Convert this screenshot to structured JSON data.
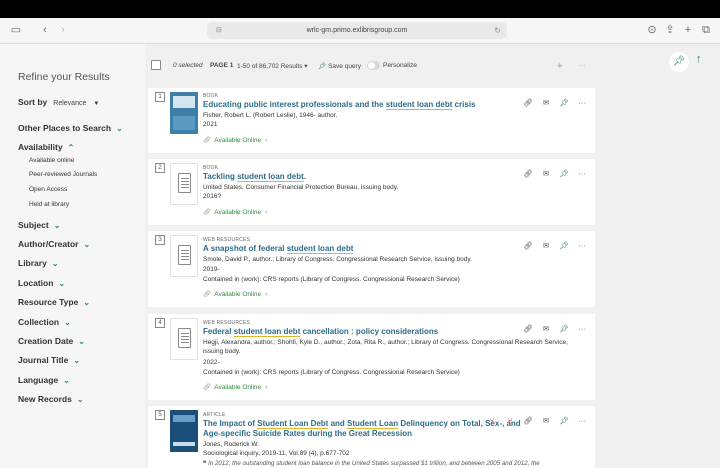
{
  "browser": {
    "url": "wrlc-gm.primo.exlibrisgroup.com"
  },
  "sidebar": {
    "title": "Refine your Results",
    "sort_by": {
      "label": "Sort by",
      "value": "Relevance"
    },
    "facets": [
      {
        "label": "Other Places to Search"
      },
      {
        "label": "Availability"
      },
      {
        "label": "Subject"
      },
      {
        "label": "Author/Creator"
      },
      {
        "label": "Library"
      },
      {
        "label": "Location"
      },
      {
        "label": "Resource Type"
      },
      {
        "label": "Collection"
      },
      {
        "label": "Creation Date"
      },
      {
        "label": "Journal Title"
      },
      {
        "label": "Language"
      },
      {
        "label": "New Records"
      }
    ],
    "availability_options": [
      "Available online",
      "Peer-reviewed Journals",
      "Open Access",
      "Held at library"
    ]
  },
  "toolbar": {
    "selected": "0 selected",
    "page": "PAGE 1",
    "results": "1-50 of 86,702 Results",
    "save_query": "Save query",
    "personalize": "Personalize"
  },
  "results": [
    {
      "num": "1",
      "type": "BOOK",
      "title_parts": [
        "Educating public interest professionals and the ",
        "student loan debt",
        " crisis"
      ],
      "lines": [
        "Fisher, Robert L. (Robert Leslie), 1946- author.",
        "2021"
      ],
      "availability": "Available Online"
    },
    {
      "num": "2",
      "type": "BOOK",
      "title_parts": [
        "Tackling ",
        "student loan debt",
        "."
      ],
      "lines": [
        "United States. Consumer Financial Protection Bureau, issuing body.",
        "2016?"
      ],
      "availability": "Available Online"
    },
    {
      "num": "3",
      "type": "WEB RESOURCES",
      "title_parts": [
        "A snapshot of federal ",
        "student loan debt",
        ""
      ],
      "lines": [
        "Smole, David P., author.; Library of Congress. Congressional Research Service, issuing body.",
        "2019-",
        "Contained in (work): CRS reports (Library of Congress. Congressional Research Service)"
      ],
      "availability": "Available Online"
    },
    {
      "num": "4",
      "type": "WEB RESOURCES",
      "title_parts": [
        "Federal ",
        "student loan debt",
        " cancellation : policy considerations"
      ],
      "lines": [
        "Hegji, Alexandra, author.; Shohfi, Kyle D., author.; Zota, Rita R., author.; Library of Congress. Congressional Research Service, issuing body.",
        "2022-",
        "Contained in (work): CRS reports (Library of Congress. Congressional Research Service)"
      ],
      "availability": "Available Online"
    },
    {
      "num": "5",
      "type": "ARTICLE",
      "title_parts": [
        "The Impact of ",
        "Student Loan Debt",
        " and ",
        "Student Loan",
        " Delinquency on Total, Sex-, and Age-specific Suicide Rates during the Great Recession"
      ],
      "lines": [
        "Jones, Roderick W.",
        "Sociological inquiry, 2019-11, Vol.89 (4), p.677-702"
      ],
      "snippet": "In 2012, the outstanding student loan balance in the United States surpassed $1 trillion, and between 2005 and 2012, the"
    }
  ],
  "icons": {
    "link": "link-icon",
    "email": "email-icon",
    "pin": "pin-icon",
    "more": "more-icon"
  },
  "colors": {
    "title_link": "#2d6c88",
    "available": "#2f8a3d",
    "accent": "#2c7a5e",
    "highlight": "#e3b52a"
  }
}
